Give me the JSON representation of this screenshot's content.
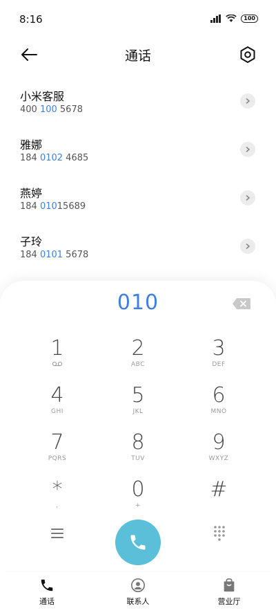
{
  "status_bar": {
    "time": "8:16",
    "battery": "100"
  },
  "header": {
    "title": "通话"
  },
  "contacts": [
    {
      "name": "小米客服",
      "number_parts": [
        "400",
        " 100",
        " 5678"
      ],
      "highlight": [
        false,
        true,
        false
      ],
      "number_full": "400 100 5678"
    },
    {
      "name": "雅娜",
      "number_parts": [
        "184 ",
        "0102",
        " 4685"
      ],
      "highlight": [
        false,
        true,
        false
      ],
      "number_full": "184 0102 4685"
    },
    {
      "name": "燕婷",
      "number_parts": [
        "184 ",
        "010",
        "15689"
      ],
      "highlight": [
        false,
        true,
        false
      ],
      "number_full": "184 01015689"
    },
    {
      "name": "子玲",
      "number_parts": [
        "184 ",
        "0101",
        " 5678"
      ],
      "highlight": [
        false,
        true,
        false
      ],
      "number_full": "184 0101 5678"
    }
  ],
  "dialer": {
    "input": "010",
    "keys": [
      {
        "digit": "1",
        "letters": "ꝏ"
      },
      {
        "digit": "2",
        "letters": "ABC"
      },
      {
        "digit": "3",
        "letters": "DEF"
      },
      {
        "digit": "4",
        "letters": "GHI"
      },
      {
        "digit": "5",
        "letters": "JKL"
      },
      {
        "digit": "6",
        "letters": "MNO"
      },
      {
        "digit": "7",
        "letters": "PQRS"
      },
      {
        "digit": "8",
        "letters": "TUV"
      },
      {
        "digit": "9",
        "letters": "WXYZ"
      },
      {
        "digit": "*",
        "letters": ","
      },
      {
        "digit": "0",
        "letters": "+"
      },
      {
        "digit": "#",
        "letters": ""
      }
    ]
  },
  "bottom_nav": {
    "items": [
      {
        "label": "通话",
        "icon": "phone-icon",
        "active": true
      },
      {
        "label": "联系人",
        "icon": "contacts-icon",
        "active": false
      },
      {
        "label": "营业厅",
        "icon": "store-icon",
        "active": false
      }
    ]
  },
  "colors": {
    "accent": "#3f7fe0",
    "call_button": "#5bbfd9"
  }
}
